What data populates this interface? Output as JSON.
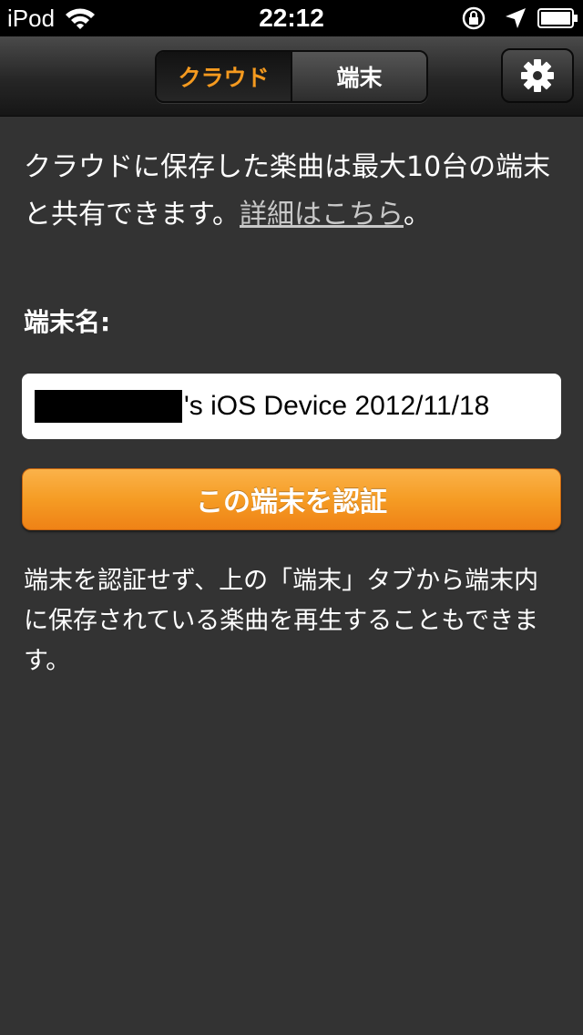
{
  "status_bar": {
    "carrier": "iPod",
    "time": "22:12"
  },
  "nav": {
    "tabs": [
      {
        "label": "クラウド",
        "active": true
      },
      {
        "label": "端末",
        "active": false
      }
    ],
    "settings_icon": "gear-icon"
  },
  "main": {
    "intro_text": "クラウドに保存した楽曲は最大10台の端末と共有できます。",
    "details_link": "詳細はこちら",
    "intro_end": "。",
    "device_label": "端末名:",
    "device_name_suffix": "'s iOS Device 2012/11/18",
    "authorize_button": "この端末を認証",
    "note_text": "端末を認証せず、上の「端末」タブから端末内に保存されている楽曲を再生することもできます。"
  },
  "colors": {
    "accent": "#f59a1f",
    "background": "#333333"
  }
}
